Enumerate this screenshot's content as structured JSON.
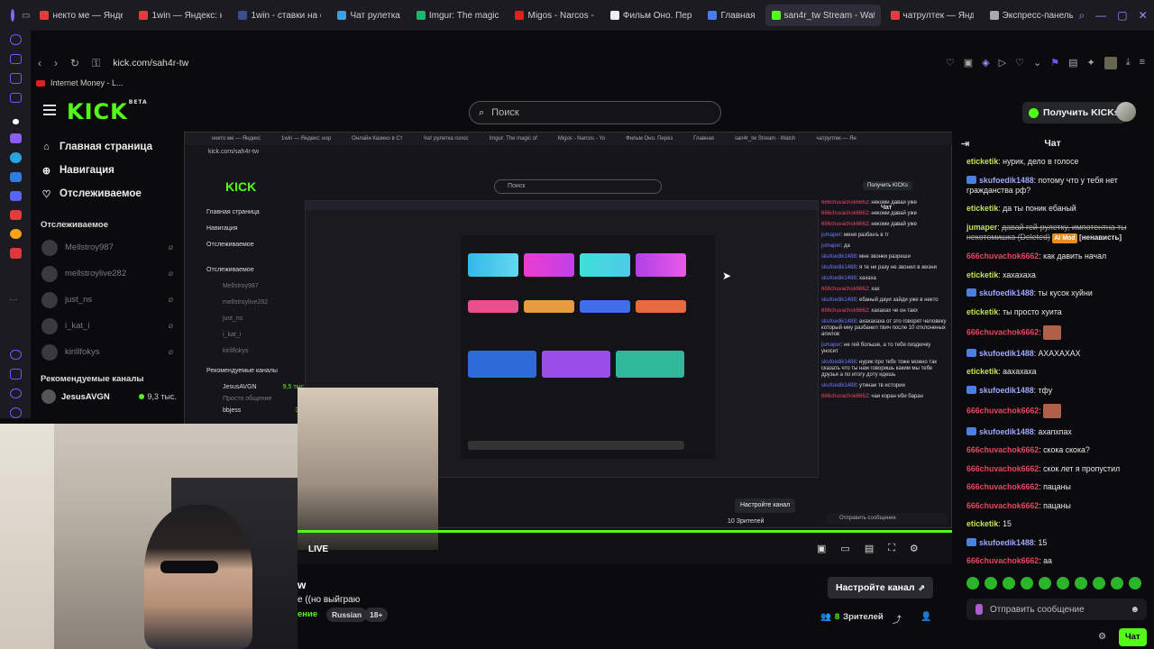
{
  "browser": {
    "tabs": [
      {
        "label": "некто ме — Яндекс",
        "color": "#e43c3c"
      },
      {
        "label": "1win — Яндекс: н",
        "color": "#e43c3c"
      },
      {
        "label": "1win - ставки на с",
        "color": "#3d4e8c"
      },
      {
        "label": "Чат рулетка",
        "color": "#3aa0e0"
      },
      {
        "label": "Imgur: The magic",
        "color": "#1bb76e"
      },
      {
        "label": "Migos - Narcos -",
        "color": "#e02020"
      },
      {
        "label": "Фильм Оно. Пер",
        "color": "#eeeeee"
      },
      {
        "label": "Главная",
        "color": "#4a7cf0"
      },
      {
        "label": "san4r_tw Stream - Watch",
        "color": "#53fc18",
        "active": true
      },
      {
        "label": "чатрултек — Янд",
        "color": "#e43c3c"
      },
      {
        "label": "Экспресс-панель",
        "color": "#aaaaaa"
      }
    ],
    "url": "kick.com/sah4r-tw",
    "bookmark": "Internet Money - L..."
  },
  "kick": {
    "search_placeholder": "Поиск",
    "get_kicks_label": "Получить KICKs",
    "logo_text": "KICK",
    "logo_beta": "BETA"
  },
  "sidebar": {
    "nav": [
      {
        "label": "Главная страница",
        "icon": "home-icon"
      },
      {
        "label": "Навигация",
        "icon": "compass-icon"
      },
      {
        "label": "Отслеживаемое",
        "icon": "heart-icon"
      }
    ],
    "following_title": "Отслеживаемое",
    "following": [
      {
        "name": "Mellstroy987"
      },
      {
        "name": "mellstroylive282"
      },
      {
        "name": "just_ns"
      },
      {
        "name": "i_kat_i"
      },
      {
        "name": "kirillfokys"
      }
    ],
    "recommended_title": "Рекомендуемые каналы",
    "recommended": [
      {
        "name": "JesusAVGN",
        "viewers": "9,3 тыс."
      }
    ]
  },
  "inner_screen": {
    "tabs": [
      "некто ме — Яндекс",
      "1win — Яндекс: нор",
      "Онлайн Казино в Ст",
      "Чат рулетка голос",
      "Imgur: The magic of",
      "Migos - Narcos - Yo",
      "Фильм Оно. Перез",
      "Главная",
      "san4r_tw Stream - Watch",
      "чатрултек — Ян"
    ],
    "url": "kick.com/sah4r-tw",
    "search": "Поиск",
    "logo": "KICK",
    "get_kicks": "Получить KICKs",
    "chat_title": "Чат",
    "nav": [
      "Главная страница",
      "Навигация",
      "Отслеживаемое"
    ],
    "following_title": "Отслеживаемое",
    "following": [
      "Mellstroy987",
      "mellstroylive282",
      "just_ns",
      "i_kat_i",
      "kirillfokys"
    ],
    "recommended_title": "Рекомендуемые каналы",
    "recommended": [
      {
        "name": "JesusAVGN",
        "viewers": "9,5 тыс."
      },
      {
        "name": "bbjess",
        "viewers": "369"
      }
    ],
    "recommended_sub": "Просто общение",
    "chat": [
      {
        "user": "666chuvachok6662",
        "text": "некоми давай уже"
      },
      {
        "user": "666chuvachok6662",
        "text": "некоми давай уже"
      },
      {
        "user": "666chuvachok6662",
        "text": "некоми давай уже"
      },
      {
        "user": "jumaper",
        "text": "меня разбанъ в тг"
      },
      {
        "user": "jumaper",
        "text": "да"
      },
      {
        "user": "skufoedik1488",
        "text": "мне звонки разреши"
      },
      {
        "user": "skufoedik1488",
        "text": "я те ни разу не звонил в жизни"
      },
      {
        "user": "skufoedik1488",
        "text": "хахаха"
      },
      {
        "user": "666chuvachok6662",
        "text": "хах"
      },
      {
        "user": "skufoedik1488",
        "text": "ебаный дауи зайди уже в некто"
      },
      {
        "user": "666chuvachok6662",
        "text": "хахахах че он такх"
      },
      {
        "user": "skufoedik1488",
        "text": "ахахахаха от это говорят человеку который ему разбанил твич после 10 отклоненых апилов"
      },
      {
        "user": "jumaper",
        "text": "не гей больше, а то тебя пиздючку уносит"
      },
      {
        "user": "skufoedik1488",
        "text": "нурик про тебх тоже можно так сказать что ты нам говоришь каким мы тебе друзья а по итогу доту идешь"
      },
      {
        "user": "skufoedik1488",
        "text": "утинаи тв истории"
      },
      {
        "user": "666chuvachok6662",
        "text": "чаи коран еби баран"
      }
    ],
    "chat_input": "Отправить сообщение",
    "setup_channel": "Настройте канал",
    "viewers": "10 Зрителей"
  },
  "player": {
    "live_label": "LIVE"
  },
  "stream": {
    "name": "w",
    "title": "е ((но выйграю",
    "category": "ение",
    "tags": [
      "Russian",
      "18+"
    ],
    "setup_button": "Настройте канал",
    "viewers_count": "8",
    "viewers_label": "Зрителей"
  },
  "chat": {
    "title": "Чат",
    "messages": [
      {
        "user": "eticketik",
        "ucls": "u-green",
        "text": "нурик, дело в голосе",
        "badge": false
      },
      {
        "user": "skufoedik1488",
        "ucls": "u-blue",
        "text": "потому что у тебя нет гражданства рф?",
        "badge": true
      },
      {
        "user": "eticketik",
        "ucls": "u-green",
        "text": "да ты поник ебаный",
        "badge": false
      },
      {
        "user": "jumaper",
        "ucls": "u-green",
        "text": "давай гей-рулетку, импотентна ты некотомишка (Deleted)",
        "deleted": true,
        "mod": "AI Mod",
        "modtext": "[ненависть]",
        "badge": false
      },
      {
        "user": "666chuvachok6662",
        "ucls": "u-red",
        "text": "как давить начал",
        "badge": false
      },
      {
        "user": "eticketik",
        "ucls": "u-green",
        "text": "хахахаха",
        "badge": false
      },
      {
        "user": "skufoedik1488",
        "ucls": "u-blue",
        "text": "ты кусок хуйни",
        "badge": true
      },
      {
        "user": "eticketik",
        "ucls": "u-green",
        "text": "ты просто хуита",
        "badge": false
      },
      {
        "user": "666chuvachok6662",
        "ucls": "u-red",
        "text": "",
        "emote": true,
        "badge": false
      },
      {
        "user": "skufoedik1488",
        "ucls": "u-blue",
        "text": "АХАХАХАХ",
        "badge": true
      },
      {
        "user": "eticketik",
        "ucls": "u-green",
        "text": "аахахаха",
        "badge": false
      },
      {
        "user": "skufoedik1488",
        "ucls": "u-blue",
        "text": "тфу",
        "badge": true
      },
      {
        "user": "666chuvachok6662",
        "ucls": "u-red",
        "text": "",
        "emote": true,
        "badge": false
      },
      {
        "user": "skufoedik1488",
        "ucls": "u-blue",
        "text": "ахапхпах",
        "badge": true
      },
      {
        "user": "666chuvachok6662",
        "ucls": "u-red",
        "text": "скока скока?",
        "badge": false
      },
      {
        "user": "666chuvachok6662",
        "ucls": "u-red",
        "text": "скок лет я пропустил",
        "badge": false
      },
      {
        "user": "666chuvachok6662",
        "ucls": "u-red",
        "text": "пацаны",
        "badge": false
      },
      {
        "user": "666chuvachok6662",
        "ucls": "u-red",
        "text": "пацаны",
        "badge": false
      },
      {
        "user": "eticketik",
        "ucls": "u-green",
        "text": "15",
        "badge": false
      },
      {
        "user": "skufoedik1488",
        "ucls": "u-blue",
        "text": "15",
        "badge": true
      },
      {
        "user": "666chuvachok6662",
        "ucls": "u-red",
        "text": "аа",
        "badge": false
      }
    ],
    "input_placeholder": "Отправить сообщение",
    "send_label": "Чат"
  },
  "colors": {
    "kick_green": "#53fc18",
    "chat_red": "#e64862",
    "chat_green": "#c2e25a",
    "chat_blue": "#9fa6ff"
  }
}
